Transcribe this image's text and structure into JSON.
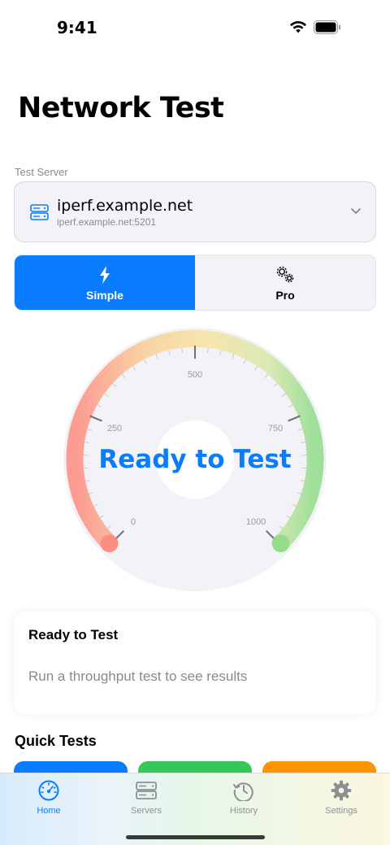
{
  "status_bar": {
    "time": "9:41"
  },
  "page_title": "Network Test",
  "server": {
    "section_label": "Test Server",
    "name": "iperf.example.net",
    "address": "iperf.example.net:5201"
  },
  "mode": {
    "options": [
      {
        "label": "Simple",
        "icon": "bolt-icon",
        "active": true
      },
      {
        "label": "Pro",
        "icon": "gears-icon",
        "active": false
      }
    ]
  },
  "gauge": {
    "status": "Ready to Test",
    "ticks": [
      "0",
      "250",
      "500",
      "750",
      "1000"
    ],
    "value": 0
  },
  "result": {
    "title": "Ready to Test",
    "description": "Run a throughput test to see results"
  },
  "quick_tests": {
    "title": "Quick Tests",
    "colors": [
      "#0a7cff",
      "#34c759",
      "#ff9500"
    ]
  },
  "tabs": [
    {
      "label": "Home",
      "icon": "speedometer-icon",
      "active": true
    },
    {
      "label": "Servers",
      "icon": "server-icon",
      "active": false
    },
    {
      "label": "History",
      "icon": "history-icon",
      "active": false
    },
    {
      "label": "Settings",
      "icon": "gear-icon",
      "active": false
    }
  ],
  "colors": {
    "accent": "#0a7cff",
    "green": "#34c759",
    "orange": "#ff9500",
    "red": "#ff6b6b"
  }
}
